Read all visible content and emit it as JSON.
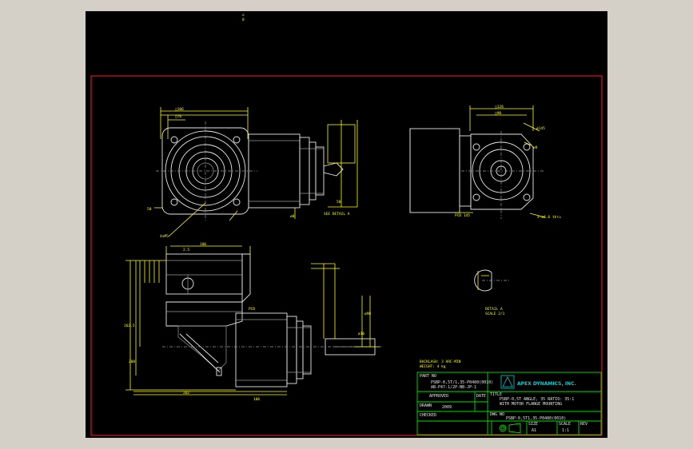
{
  "drawing": {
    "weight_line1": "BACKLASH: 3 ARC-MIN",
    "weight_line2": "WEIGHT: 4 kg",
    "detail_label": "DETAIL A",
    "detail_scale": "SCALE 2/1",
    "company": "APEX DYNAMICS, INC.",
    "part_name_line1": "PSBP-0,5T/1,35-P0480(0010)",
    "part_name_line2": "AB-P47-1/2P-NB-JP-1",
    "title_line1": "PSBP-0,5T ANGLE, 35  RATIO: 35:1",
    "title_line2": "WITH MOTOR FLANGE MOUNTING",
    "drawing_no": "PSBP-0,5T1,35-P0480(0010)",
    "size": "A1",
    "scale": "1:1",
    "sheet": "1/1",
    "labels": {
      "approved": "APPROVED",
      "date": "DATE",
      "title": "TITLE",
      "drawn": "DRAWN",
      "checked": "CHECKED",
      "dwg_no": "DWG NO",
      "size": "SIZE",
      "scale": "SCALE",
      "rev": "REV",
      "part_no": "PART NO",
      "drawn_value": "2009"
    }
  }
}
